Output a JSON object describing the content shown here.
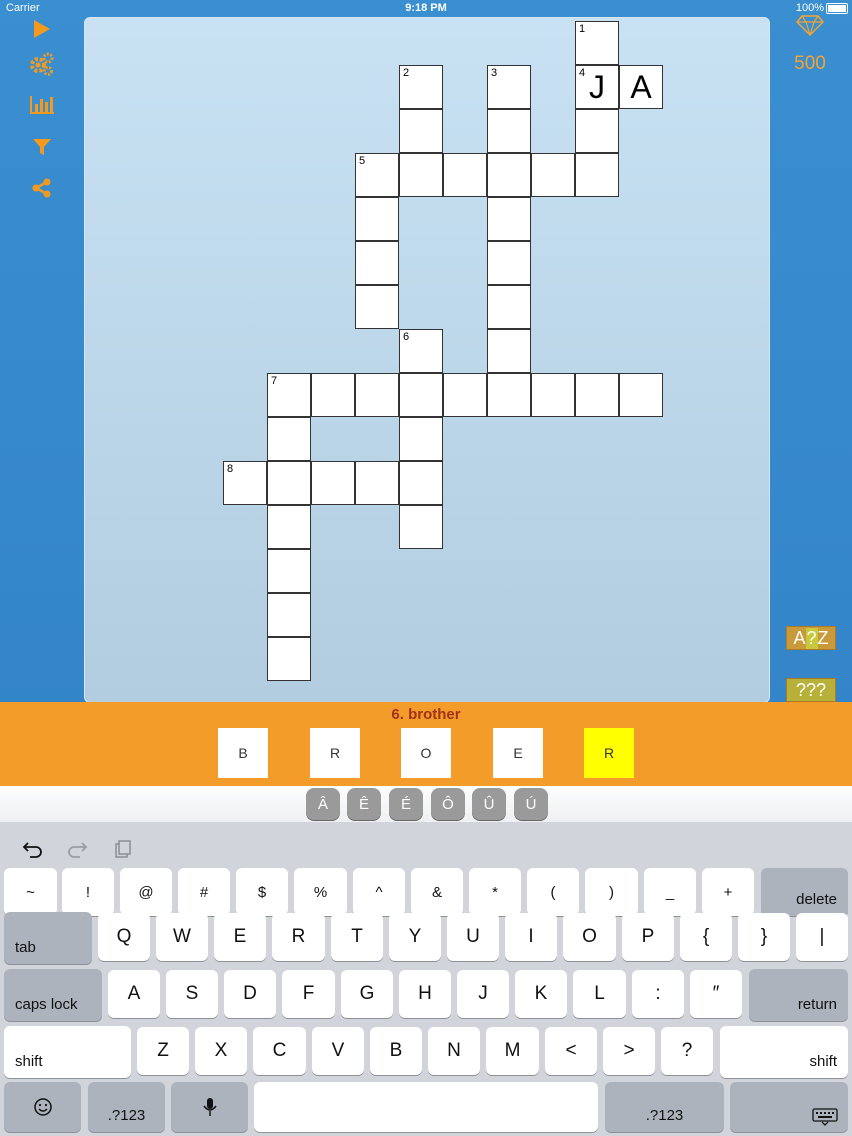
{
  "status": {
    "carrier": "Carrier",
    "time": "9:18 PM",
    "battery": "100%"
  },
  "sidebar": {
    "icons": [
      "play-icon",
      "gears-icon",
      "bar-chart-icon",
      "filter-icon",
      "share-icon"
    ]
  },
  "coins": "500",
  "hints": {
    "reveal_letter": [
      "A",
      "?",
      "Z"
    ],
    "reveal_word": [
      "?",
      "?",
      "?"
    ]
  },
  "crossword": {
    "numbers": [
      "1",
      "2",
      "3",
      "4",
      "5",
      "6",
      "7",
      "8"
    ],
    "letters": [
      "J",
      "A"
    ]
  },
  "clue": {
    "text": "6. brother"
  },
  "tiles": [
    "B",
    "R",
    "O",
    "E",
    "R"
  ],
  "accents": [
    "Â",
    "Ê",
    "É",
    "Ô",
    "Û",
    "Ú"
  ],
  "keyboard": {
    "row1": [
      "~",
      "!",
      "@",
      "#",
      "$",
      "%",
      "^",
      "&",
      "*",
      "(",
      ")",
      "_",
      "+"
    ],
    "delete": "delete",
    "tab": "tab",
    "row2": [
      "Q",
      "W",
      "E",
      "R",
      "T",
      "Y",
      "U",
      "I",
      "O",
      "P",
      "{",
      "}",
      "|"
    ],
    "caps": "caps lock",
    "row3": [
      "A",
      "S",
      "D",
      "F",
      "G",
      "H",
      "J",
      "K",
      "L",
      ":",
      "″"
    ],
    "return": "return",
    "shift": "shift",
    "row4": [
      "Z",
      "X",
      "C",
      "V",
      "B",
      "N",
      "M",
      "<",
      ">",
      "?"
    ],
    "numkey": ".?123"
  },
  "colors": {
    "accent": "#f39c2a",
    "clue": "#a3321a",
    "selected_tile": "#ffff00"
  }
}
